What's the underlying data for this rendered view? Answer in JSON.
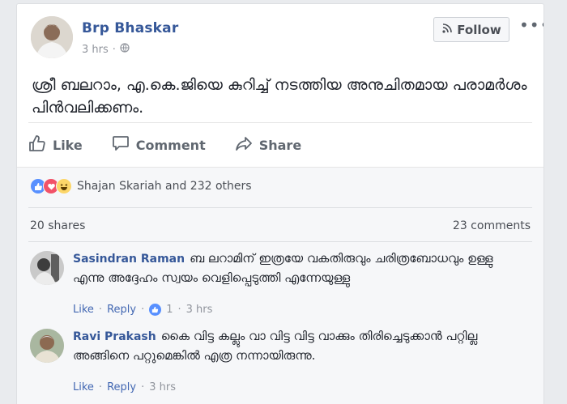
{
  "post": {
    "author": "Brp Bhaskar",
    "time": "3 hrs",
    "follow_label": "Follow",
    "more_glyph": "•••",
    "text": "ശ്രീ ബലറാം, എ.കെ.ജിയെ കുറിച്ച് നടത്തിയ അനുചിതമായ പരാമർശം പിൻവലിക്കണം."
  },
  "actions": {
    "like": "Like",
    "comment": "Comment",
    "share": "Share"
  },
  "reactions": {
    "icons": [
      "like-icon",
      "love-icon",
      "haha-icon"
    ],
    "summary": "Shajan Skariah and 232 others"
  },
  "stats": {
    "shares": "20 shares",
    "comments": "23 comments"
  },
  "comments": [
    {
      "name": "Sasindran Raman",
      "text": "ബ ലറാമിന് ഇത്രയേ വകതിരുവും ചരിത്രബോധവും ഉള്ളു എന്നു അദ്ദേഹം സ്വയം വെളിപ്പെടുത്തി എന്നേയുള്ളു",
      "like": "Like",
      "reply": "Reply",
      "reaction_count": "1",
      "time": "3 hrs"
    },
    {
      "name": "Ravi Prakash",
      "text": "കൈ വിട്ട കല്ലും വാ വിട്ട വിട്ട വാക്കും തിരിച്ചെടുക്കാൻ പറ്റില്ല അങ്ങിനെ പറ്റുമെങ്കിൽ എത്ര നന്നായിരുന്നു.",
      "like": "Like",
      "reply": "Reply",
      "time": "3 hrs"
    }
  ],
  "colors": {
    "link": "#365899",
    "like_blue": "#5890ff",
    "love_red": "#f25268",
    "haha_yellow": "#fcd669"
  }
}
